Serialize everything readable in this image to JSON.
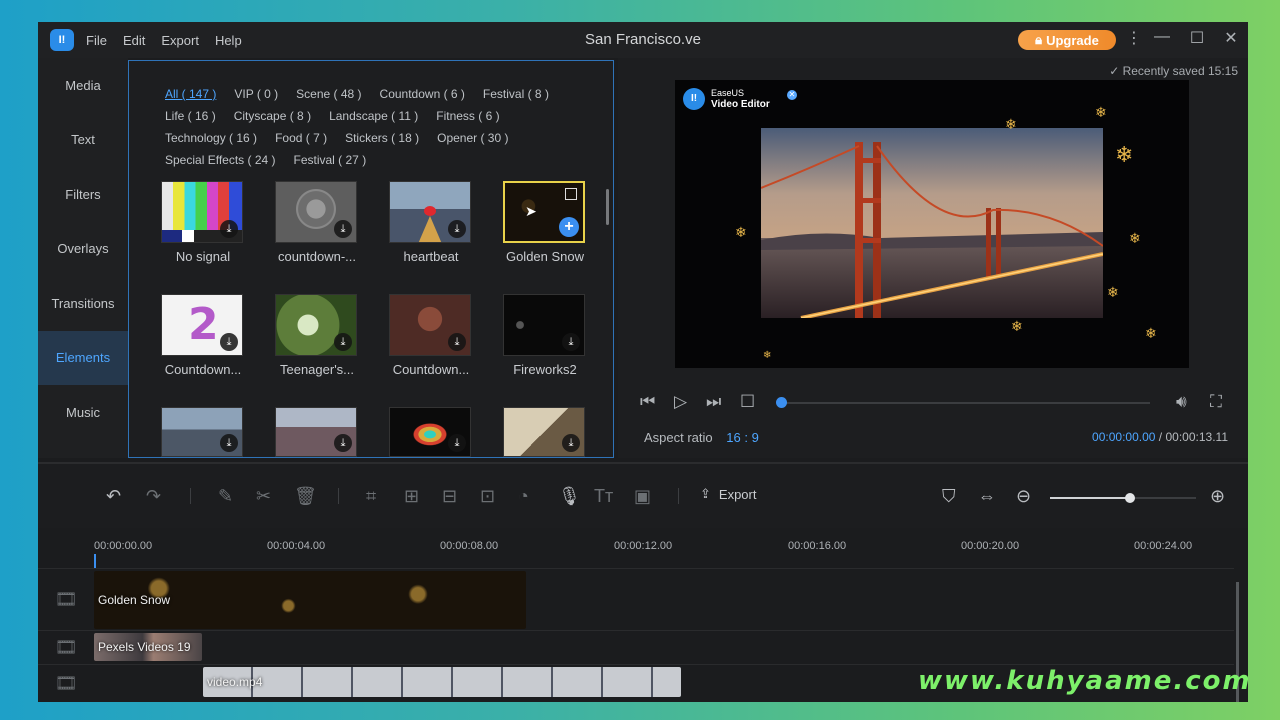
{
  "window": {
    "title": "San Francisco.ve",
    "menu": [
      "File",
      "Edit",
      "Export",
      "Help"
    ],
    "upgrade_label": "Upgrade",
    "logo_text": "I!"
  },
  "leftnav": {
    "items": [
      "Media",
      "Text",
      "Filters",
      "Overlays",
      "Transitions",
      "Elements",
      "Music"
    ],
    "active": "Elements"
  },
  "elements_panel": {
    "categories": [
      "All ( 147 )",
      "VIP ( 0 )",
      "Scene ( 48 )",
      "Countdown ( 6 )",
      "Festival ( 8 )",
      "Life ( 16 )",
      "Cityscape ( 8 )",
      "Landscape ( 11 )",
      "Fitness ( 6 )",
      "Technology ( 16 )",
      "Food ( 7 )",
      "Stickers ( 18 )",
      "Opener ( 30 )",
      "Special Effects ( 24 )",
      "Festival ( 27 )"
    ],
    "selected_category": "All ( 147 )",
    "items": [
      {
        "label": "No signal",
        "icon": "download-icon"
      },
      {
        "label": "countdown-...",
        "icon": "download-icon"
      },
      {
        "label": "heartbeat",
        "icon": "download-icon"
      },
      {
        "label": "Golden Snow",
        "icon": "add-icon",
        "selected": true
      },
      {
        "label": "Countdown...",
        "icon": "download-icon"
      },
      {
        "label": "Teenager's...",
        "icon": "download-icon"
      },
      {
        "label": "Countdown...",
        "icon": "download-icon"
      },
      {
        "label": "Fireworks2",
        "icon": "download-icon"
      },
      {
        "label": "",
        "icon": "download-icon"
      },
      {
        "label": "",
        "icon": "download-icon"
      },
      {
        "label": "",
        "icon": "download-icon"
      },
      {
        "label": "",
        "icon": "download-icon"
      }
    ]
  },
  "preview": {
    "saved_text": "Recently saved 15:15",
    "watermark_brand": "EaseUS",
    "watermark_product": "Video Editor",
    "aspect_label": "Aspect ratio",
    "aspect_value": "16 : 9",
    "current_time": "00:00:00.00",
    "separator": "/",
    "total_time": "00:00:13.11",
    "progress": 0.0
  },
  "toolbar": {
    "export_label": "Export",
    "zoom_level": 0.55
  },
  "timeline": {
    "ruler": [
      "00:00:00.00",
      "00:00:04.00",
      "00:00:08.00",
      "00:00:12.00",
      "00:00:16.00",
      "00:00:20.00",
      "00:00:24.00"
    ],
    "tracks": [
      {
        "clip_label": "Golden Snow"
      },
      {
        "clip_label": "Pexels Videos 19"
      },
      {
        "clip_label": "video.mp4"
      }
    ]
  },
  "site_watermark": "www.kuhyaame.com",
  "colors": {
    "accent": "#3b8ff0",
    "upgrade": "#f29433",
    "selected_border": "#e8d24a",
    "watermark": "#7df06a"
  }
}
